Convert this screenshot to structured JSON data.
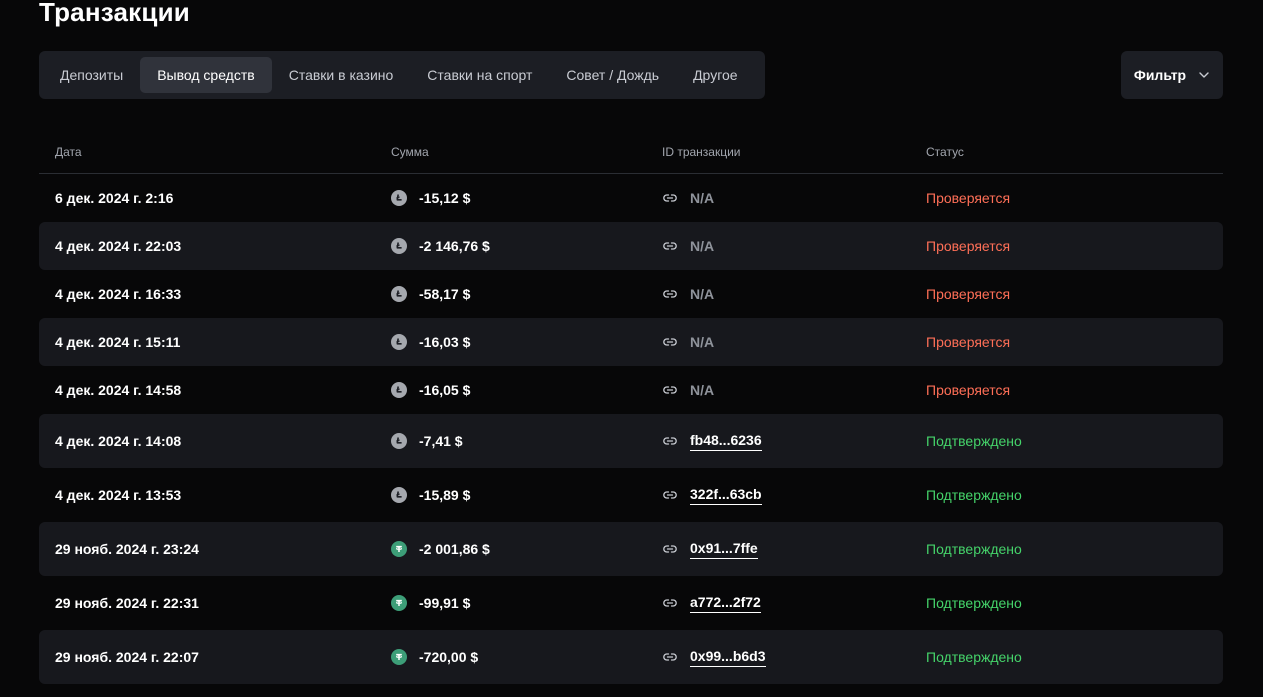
{
  "page_title": "Транзакции",
  "tabs": [
    {
      "label": "Депозиты",
      "active": false
    },
    {
      "label": "Вывод средств",
      "active": true
    },
    {
      "label": "Ставки в казино",
      "active": false
    },
    {
      "label": "Ставки на спорт",
      "active": false
    },
    {
      "label": "Совет / Дождь",
      "active": false
    },
    {
      "label": "Другое",
      "active": false
    }
  ],
  "filter": {
    "label": "Фильтр",
    "icon": "chevron-down-icon"
  },
  "table": {
    "headers": {
      "date": "Дата",
      "amount": "Сумма",
      "txid": "ID транзакции",
      "status": "Статус"
    },
    "rows": [
      {
        "date": "6 дек. 2024 г. 2:16",
        "currency": "ltc",
        "amount": "-15,12 $",
        "txid": "N/A",
        "tx_link": false,
        "status": "Проверяется",
        "status_type": "pending"
      },
      {
        "date": "4 дек. 2024 г. 22:03",
        "currency": "ltc",
        "amount": "-2 146,76 $",
        "txid": "N/A",
        "tx_link": false,
        "status": "Проверяется",
        "status_type": "pending"
      },
      {
        "date": "4 дек. 2024 г. 16:33",
        "currency": "ltc",
        "amount": "-58,17 $",
        "txid": "N/A",
        "tx_link": false,
        "status": "Проверяется",
        "status_type": "pending"
      },
      {
        "date": "4 дек. 2024 г. 15:11",
        "currency": "ltc",
        "amount": "-16,03 $",
        "txid": "N/A",
        "tx_link": false,
        "status": "Проверяется",
        "status_type": "pending"
      },
      {
        "date": "4 дек. 2024 г. 14:58",
        "currency": "ltc",
        "amount": "-16,05 $",
        "txid": "N/A",
        "tx_link": false,
        "status": "Проверяется",
        "status_type": "pending"
      },
      {
        "date": "4 дек. 2024 г. 14:08",
        "currency": "ltc",
        "amount": "-7,41 $",
        "txid": "fb48...6236",
        "tx_link": true,
        "status": "Подтверждено",
        "status_type": "confirmed"
      },
      {
        "date": "4 дек. 2024 г. 13:53",
        "currency": "ltc",
        "amount": "-15,89 $",
        "txid": "322f...63cb",
        "tx_link": true,
        "status": "Подтверждено",
        "status_type": "confirmed"
      },
      {
        "date": "29 нояб. 2024 г. 23:24",
        "currency": "usdt",
        "amount": "-2 001,86 $",
        "txid": "0x91...7ffe",
        "tx_link": true,
        "status": "Подтверждено",
        "status_type": "confirmed"
      },
      {
        "date": "29 нояб. 2024 г. 22:31",
        "currency": "usdt",
        "amount": "-99,91 $",
        "txid": "a772...2f72",
        "tx_link": true,
        "status": "Подтверждено",
        "status_type": "confirmed"
      },
      {
        "date": "29 нояб. 2024 г. 22:07",
        "currency": "usdt",
        "amount": "-720,00 $",
        "txid": "0x99...b6d3",
        "tx_link": true,
        "status": "Подтверждено",
        "status_type": "confirmed"
      }
    ]
  },
  "colors": {
    "pending": "#ff6f57",
    "confirmed": "#45d36a",
    "ltc": "#a5a8ae",
    "usdt": "#3d9e78"
  }
}
